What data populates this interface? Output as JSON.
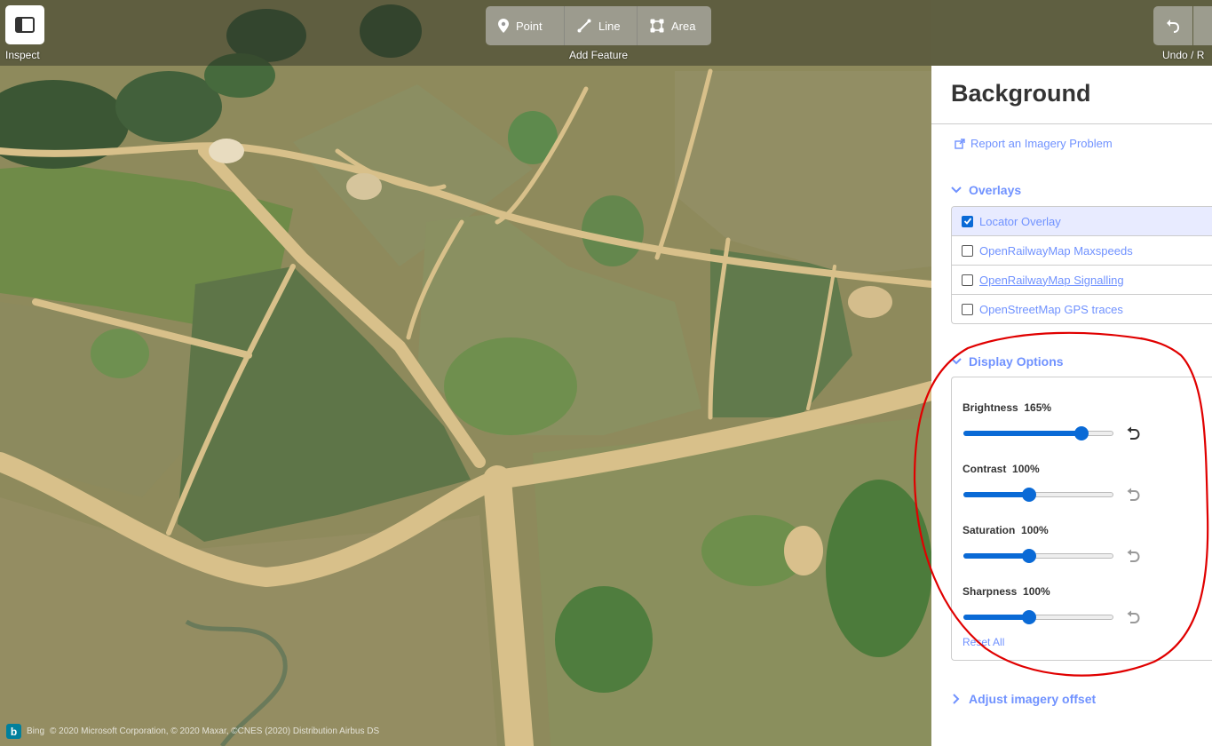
{
  "toolbar": {
    "inspect_label": "Inspect",
    "add_feature_label": "Add Feature",
    "undo_redo_label": "Undo / R",
    "modes": [
      {
        "label": "Point",
        "icon": "map-pin-icon"
      },
      {
        "label": "Line",
        "icon": "line-icon"
      },
      {
        "label": "Area",
        "icon": "area-icon"
      }
    ]
  },
  "panel": {
    "title": "Background",
    "report_link": "Report an Imagery Problem",
    "overlays": {
      "heading": "Overlays",
      "items": [
        {
          "label": "Locator Overlay",
          "checked": true
        },
        {
          "label": "OpenRailwayMap Maxspeeds",
          "checked": false
        },
        {
          "label": "OpenRailwayMap Signalling",
          "checked": false
        },
        {
          "label": "OpenStreetMap GPS traces",
          "checked": false
        }
      ]
    },
    "display_options": {
      "heading": "Display Options",
      "options": [
        {
          "name": "Brightness",
          "value": "165%",
          "fraction": 0.78,
          "reset_active": true
        },
        {
          "name": "Contrast",
          "value": "100%",
          "fraction": 0.43,
          "reset_active": false
        },
        {
          "name": "Saturation",
          "value": "100%",
          "fraction": 0.43,
          "reset_active": false
        },
        {
          "name": "Sharpness",
          "value": "100%",
          "fraction": 0.43,
          "reset_active": false
        }
      ],
      "reset_all": "Reset All"
    },
    "offset": {
      "heading": "Adjust imagery offset"
    }
  },
  "attribution": {
    "provider": "Bing",
    "text": "© 2020 Microsoft Corporation, © 2020 Maxar, ©CNES (2020) Distribution Airbus DS"
  },
  "colors": {
    "accent": "#7092ff",
    "slider": "#0a6ad6",
    "annotation": "#e00000"
  }
}
